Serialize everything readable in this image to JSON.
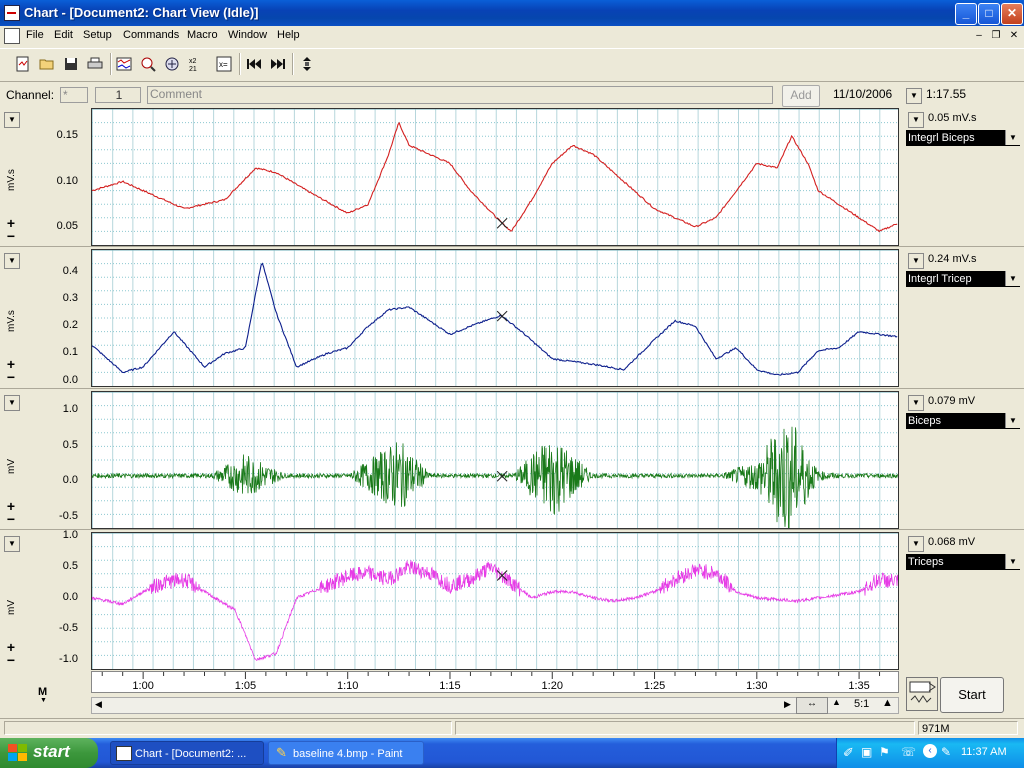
{
  "window": {
    "title": "Chart - [Document2: Chart View (Idle)]",
    "minimize": "_",
    "maximize": "□",
    "close": "✕"
  },
  "menu": [
    "File",
    "Edit",
    "Setup",
    "Commands",
    "Macro",
    "Window",
    "Help"
  ],
  "mdi_controls": {
    "minimize": "–",
    "restore": "❐",
    "close": "✕"
  },
  "toolbar": {
    "buttons": [
      "new-document-icon",
      "open-folder-icon",
      "save-icon",
      "print-icon",
      "chart-view-icon",
      "zoom-view-icon",
      "data-pad-icon",
      "sort-icon",
      "calculator-icon",
      "go-to-start-icon",
      "go-to-end-icon",
      "scale-icon"
    ]
  },
  "channel_bar": {
    "channel_label": "Channel:",
    "channel_value": "*",
    "number_value": "1",
    "comment_placeholder": "Comment",
    "add_label": "Add",
    "date": "11/10/2006",
    "time": "1:17.55"
  },
  "channels": [
    {
      "unit": "mV.s",
      "ticks": [
        "0.15",
        "0.10",
        "0.05"
      ],
      "readout": "0.05 mV.s",
      "name": "Integrl Biceps",
      "color": "#d42020"
    },
    {
      "unit": "mV.s",
      "ticks": [
        "0.4",
        "0.3",
        "0.2",
        "0.1",
        "0.0"
      ],
      "readout": "0.24 mV.s",
      "name": "Integrl Tricep",
      "color": "#0c1e8c"
    },
    {
      "unit": "mV",
      "ticks": [
        "1.0",
        "0.5",
        "0.0",
        "-0.5"
      ],
      "readout": "0.079 mV",
      "name": "Biceps",
      "color": "#1a7a1a"
    },
    {
      "unit": "mV",
      "ticks": [
        "1.0",
        "0.5",
        "0.0",
        "-0.5",
        "-1.0"
      ],
      "readout": "0.068 mV",
      "name": "Triceps",
      "color": "#e63ce6"
    }
  ],
  "chart_data": {
    "type": "line",
    "x_unit": "time (m:ss)",
    "xlim": [
      "0:57.5",
      "1:37"
    ],
    "x_ticks": [
      "1:00",
      "1:05",
      "1:10",
      "1:15",
      "1:20",
      "1:25",
      "1:30",
      "1:35"
    ],
    "cursor_time": "1:17.55",
    "series": [
      {
        "name": "Integrl Biceps",
        "ylim": [
          0.03,
          0.18
        ],
        "x": [
          "0:57.5",
          "0:59",
          "1:00",
          "1:02",
          "1:04",
          "1:05.5",
          "1:06.5",
          "1:08",
          "1:10",
          "1:11",
          "1:12",
          "1:12.5",
          "1:13",
          "1:15",
          "1:16",
          "1:17.5",
          "1:18",
          "1:19",
          "1:20",
          "1:21",
          "1:22",
          "1:23",
          "1:24",
          "1:25",
          "1:27",
          "1:28",
          "1:29",
          "1:30",
          "1:31",
          "1:31.7",
          "1:32.5",
          "1:33",
          "1:35",
          "1:36",
          "1:37"
        ],
        "values": [
          0.09,
          0.1,
          0.09,
          0.07,
          0.08,
          0.115,
          0.11,
          0.09,
          0.065,
          0.075,
          0.13,
          0.165,
          0.14,
          0.12,
          0.09,
          0.055,
          0.045,
          0.08,
          0.12,
          0.14,
          0.13,
          0.11,
          0.09,
          0.07,
          0.05,
          0.06,
          0.09,
          0.12,
          0.115,
          0.15,
          0.12,
          0.09,
          0.06,
          0.045,
          0.055
        ]
      },
      {
        "name": "Integrl Tricep",
        "ylim": [
          -0.02,
          0.48
        ],
        "x": [
          "0:57.5",
          "0:59",
          "1:00",
          "1:01.5",
          "1:03",
          "1:04",
          "1:05",
          "1:05.8",
          "1:06.5",
          "1:07.5",
          "1:09",
          "1:10",
          "1:11",
          "1:12",
          "1:13",
          "1:14",
          "1:15",
          "1:16",
          "1:17.5",
          "1:18.5",
          "1:20",
          "1:22",
          "1:23.5",
          "1:25",
          "1:26",
          "1:27",
          "1:28",
          "1:29",
          "1:30",
          "1:31",
          "1:32",
          "1:33",
          "1:34",
          "1:35",
          "1:36",
          "1:37"
        ],
        "values": [
          0.13,
          0.03,
          0.05,
          0.18,
          0.05,
          0.1,
          0.12,
          0.44,
          0.25,
          0.05,
          0.1,
          0.12,
          0.2,
          0.26,
          0.27,
          0.22,
          0.17,
          0.2,
          0.24,
          0.18,
          0.08,
          0.06,
          0.04,
          0.15,
          0.22,
          0.2,
          0.08,
          0.12,
          0.04,
          0.02,
          0.03,
          0.11,
          0.12,
          0.18,
          0.17,
          0.16
        ]
      },
      {
        "name": "Biceps",
        "ylim": [
          -0.65,
          1.25
        ],
        "x": [
          "0:57.5",
          "1:00",
          "1:03",
          "1:05",
          "1:07",
          "1:10",
          "1:12.5",
          "1:14",
          "1:16",
          "1:18",
          "1:20",
          "1:22",
          "1:25",
          "1:28",
          "1:30",
          "1:31.5",
          "1:33",
          "1:35",
          "1:37"
        ],
        "values": [
          0.1,
          0.08,
          0.05,
          0.4,
          0.1,
          0.1,
          0.6,
          0.12,
          0.05,
          0.08,
          0.7,
          0.1,
          0.05,
          0.08,
          0.3,
          1.0,
          0.15,
          0.08,
          0.1
        ]
      },
      {
        "name": "Triceps",
        "ylim": [
          -1.15,
          1.05
        ],
        "x": [
          "0:57.5",
          "0:59",
          "1:00",
          "1:01",
          "1:02",
          "1:03.5",
          "1:04.5",
          "1:05",
          "1:05.5",
          "1:06.5",
          "1:07.5",
          "1:09",
          "1:10",
          "1:11",
          "1:12",
          "1:13",
          "1:14",
          "1:15",
          "1:16",
          "1:17",
          "1:18",
          "1:19",
          "1:20",
          "1:21",
          "1:22",
          "1:23",
          "1:24",
          "1:25",
          "1:26",
          "1:27",
          "1:28",
          "1:29",
          "1:30",
          "1:32",
          "1:33",
          "1:34",
          "1:35",
          "1:36",
          "1:37"
        ],
        "values": [
          0.0,
          -0.1,
          0.1,
          0.25,
          0.3,
          0.0,
          -0.2,
          -0.6,
          -1.0,
          -0.9,
          0.0,
          0.2,
          0.35,
          0.4,
          0.3,
          0.5,
          0.4,
          0.2,
          0.3,
          0.5,
          0.25,
          0.0,
          0.1,
          0.1,
          0.0,
          -0.05,
          0.0,
          0.1,
          0.3,
          0.45,
          0.4,
          0.1,
          0.0,
          -0.05,
          0.0,
          0.05,
          0.1,
          0.3,
          0.25
        ]
      }
    ]
  },
  "bottom": {
    "view_marker": "M",
    "compression": "5:1",
    "start_label": "Start",
    "status_memory": "971M"
  },
  "taskbar": {
    "start_label": "start",
    "tasks": [
      "Chart - [Document2: ...",
      "baseline 4.bmp - Paint"
    ],
    "clock": "11:37 AM"
  }
}
